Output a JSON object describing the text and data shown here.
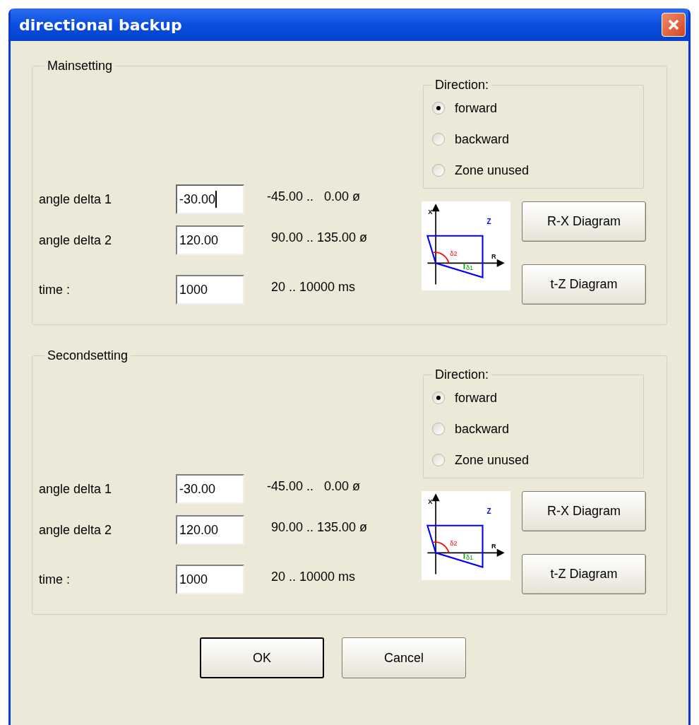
{
  "window": {
    "title": "directional backup"
  },
  "groups": [
    {
      "title": "Mainsetting",
      "fields": [
        {
          "label": "angle delta 1",
          "value": "-30.00",
          "focused": true,
          "range": "-45.00 ..   0.00 ø"
        },
        {
          "label": "angle delta 2",
          "value": "120.00",
          "focused": false,
          "range": "90.00 .. 135.00 ø"
        },
        {
          "label": "time :",
          "value": "1000",
          "focused": false,
          "range": "20 .. 10000 ms"
        }
      ],
      "direction": {
        "title": "Direction:",
        "options": [
          {
            "label": "forward",
            "selected": true
          },
          {
            "label": "backward",
            "selected": false
          },
          {
            "label": "Zone unused",
            "selected": false
          }
        ]
      },
      "diagram": {
        "x_axis": "X",
        "r_axis": "R",
        "zone": "Z",
        "angle_2": "δ2",
        "angle_1": "δ1"
      },
      "buttons": [
        "R-X Diagram",
        "t-Z Diagram"
      ]
    },
    {
      "title": "Secondsetting",
      "fields": [
        {
          "label": "angle delta 1",
          "value": "-30.00",
          "focused": false,
          "range": "-45.00 ..   0.00 ø"
        },
        {
          "label": "angle delta 2",
          "value": "120.00",
          "focused": false,
          "range": "90.00 .. 135.00 ø"
        },
        {
          "label": "time :",
          "value": "1000",
          "focused": false,
          "range": "20 .. 10000 ms"
        }
      ],
      "direction": {
        "title": "Direction:",
        "options": [
          {
            "label": "forward",
            "selected": true
          },
          {
            "label": "backward",
            "selected": false
          },
          {
            "label": "Zone unused",
            "selected": false
          }
        ]
      },
      "diagram": {
        "x_axis": "X",
        "r_axis": "R",
        "zone": "Z",
        "angle_2": "δ2",
        "angle_1": "δ1"
      },
      "buttons": [
        "R-X Diagram",
        "t-Z Diagram"
      ]
    }
  ],
  "footer_buttons": [
    {
      "label": "OK",
      "default": true
    },
    {
      "label": "Cancel",
      "default": false
    }
  ]
}
